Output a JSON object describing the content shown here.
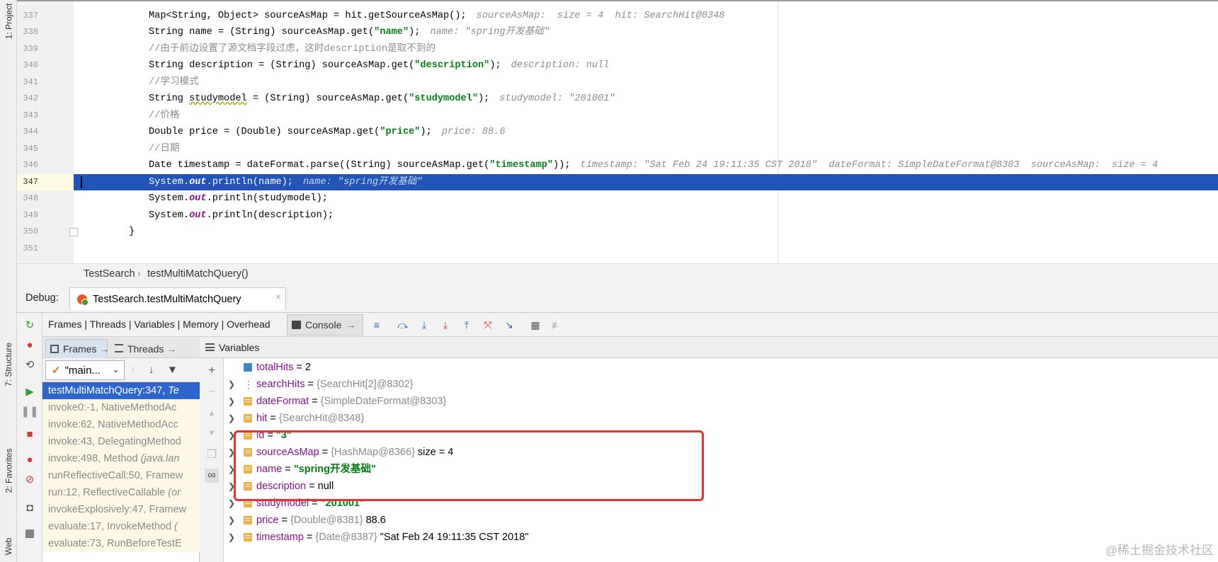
{
  "left_strip": {
    "project_tab": "1: Project",
    "structure_tab": "7: Structure",
    "favorites_tab": "2: Favorites",
    "web_tab": "Web"
  },
  "editor": {
    "lines": [
      {
        "n": "337",
        "code": "Map<String, Object> sourceAsMap = hit.getSourceAsMap();",
        "hint": "sourceAsMap:  size = 4  hit: SearchHit@8348"
      },
      {
        "n": "338",
        "code": "String name = (String) sourceAsMap.get(\"name\");",
        "hint": "name: \"spring开发基础\""
      },
      {
        "n": "339",
        "code": "//由于前边设置了源文档字段过虑，这时description是取不到的",
        "hint": ""
      },
      {
        "n": "340",
        "code": "String description = (String) sourceAsMap.get(\"description\");",
        "hint": "description: null"
      },
      {
        "n": "341",
        "code": "//学习模式",
        "hint": ""
      },
      {
        "n": "342",
        "code": "String studymodel = (String) sourceAsMap.get(\"studymodel\");",
        "hint": "studymodel: \"201001\""
      },
      {
        "n": "343",
        "code": "//价格",
        "hint": ""
      },
      {
        "n": "344",
        "code": "Double price = (Double) sourceAsMap.get(\"price\");",
        "hint": "price: 88.6"
      },
      {
        "n": "345",
        "code": "//日期",
        "hint": ""
      },
      {
        "n": "346",
        "code": "Date timestamp = dateFormat.parse((String) sourceAsMap.get(\"timestamp\"));",
        "hint": "timestamp: \"Sat Feb 24 19:11:35 CST 2018\"  dateFormat: SimpleDateFormat@8303  sourceAsMap:  size = 4"
      },
      {
        "n": "347",
        "code": "System.out.println(name);",
        "hint": "name: \"spring开发基础\""
      },
      {
        "n": "348",
        "code": "System.out.println(studymodel);",
        "hint": ""
      },
      {
        "n": "349",
        "code": "System.out.println(description);",
        "hint": ""
      },
      {
        "n": "350",
        "code": "}",
        "hint": ""
      },
      {
        "n": "351",
        "code": "",
        "hint": ""
      }
    ]
  },
  "breadcrumb": {
    "class_name": "TestSearch",
    "separator": "›",
    "method_name": "testMultiMatchQuery()"
  },
  "debug": {
    "label": "Debug:",
    "session_tab": "TestSearch.testMultiMatchQuery",
    "views_label": "Frames | Threads | Variables | Memory | Overhead",
    "console_tab": "Console",
    "frames_tab": "Frames",
    "threads_tab": "Threads",
    "thread_selected": "\"main...",
    "variables_title": "Variables"
  },
  "frames": [
    {
      "method": "testMultiMatchQuery:347, ",
      "cls": "Te"
    },
    {
      "method": "invoke0:-1, NativeMethodAc",
      "cls": ""
    },
    {
      "method": "invoke:62, NativeMethodAcc",
      "cls": ""
    },
    {
      "method": "invoke:43, DelegatingMethod",
      "cls": ""
    },
    {
      "method": "invoke:498, Method ",
      "cls": "(java.lan"
    },
    {
      "method": "runReflectiveCall:50, Framew",
      "cls": ""
    },
    {
      "method": "run:12, ReflectiveCallable ",
      "cls": "(or"
    },
    {
      "method": "invokeExplosively:47, Framew",
      "cls": ""
    },
    {
      "method": "evaluate:17, InvokeMethod ",
      "cls": "("
    },
    {
      "method": "evaluate:73, RunBeforeTestE",
      "cls": ""
    }
  ],
  "variables": [
    {
      "name": "totalHits",
      "eq": " = ",
      "type": "",
      "value": "2",
      "kind": "plain"
    },
    {
      "name": "searchHits",
      "eq": " = ",
      "type": "{SearchHit[2]@8302}",
      "value": "",
      "kind": "plain"
    },
    {
      "name": "dateFormat",
      "eq": " = ",
      "type": "{SimpleDateFormat@8303}",
      "value": "",
      "kind": "plain"
    },
    {
      "name": "hit",
      "eq": " = ",
      "type": "{SearchHit@8348}",
      "value": "",
      "kind": "plain"
    },
    {
      "name": "id",
      "eq": " = ",
      "type": "",
      "value": "\"3\"",
      "kind": "str"
    },
    {
      "name": "sourceAsMap",
      "eq": " = ",
      "type": "{HashMap@8366}",
      "value": " size = 4",
      "kind": "plain"
    },
    {
      "name": "name",
      "eq": " = ",
      "type": "",
      "value": "\"spring开发基础\"",
      "kind": "str"
    },
    {
      "name": "description",
      "eq": " = ",
      "type": "",
      "value": "null",
      "kind": "plain"
    },
    {
      "name": "studymodel",
      "eq": " = ",
      "type": "",
      "value": "\"201001\"",
      "kind": "str"
    },
    {
      "name": "price",
      "eq": " = ",
      "type": "{Double@8381}",
      "value": " 88.6",
      "kind": "plain"
    },
    {
      "name": "timestamp",
      "eq": " = ",
      "type": "{Date@8387}",
      "value": " \"Sat Feb 24 19:11:35 CST 2018\"",
      "kind": "plain"
    }
  ],
  "watermark": "@稀土掘金技术社区",
  "colors": {
    "exec_line": "#2154b6",
    "selected_frame": "#2f65ca",
    "highlight_box": "#e53333",
    "string_value": "#067d17",
    "var_name": "#871094"
  }
}
